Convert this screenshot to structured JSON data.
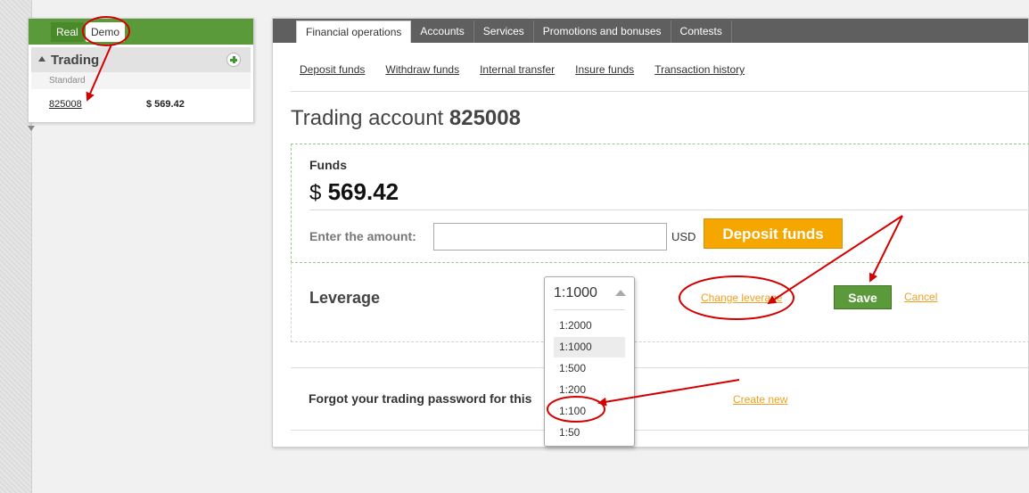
{
  "left_panel": {
    "tabs": [
      "Real",
      "Demo"
    ],
    "section_title": "Trading",
    "sub_label": "Standard",
    "account_number": "825008",
    "balance": "$ 569.42"
  },
  "main": {
    "tabs": [
      "Financial operations",
      "Accounts",
      "Services",
      "Promotions and bonuses",
      "Contests"
    ],
    "subnav": [
      "Deposit funds",
      "Withdraw funds",
      "Internal transfer",
      "Insure funds",
      "Transaction history"
    ],
    "title_prefix": "Trading account",
    "title_account": "825008",
    "funds_label": "Funds",
    "funds_currency": "$",
    "funds_value": "569.42",
    "enter_amount_label": "Enter the amount:",
    "amount_value": "",
    "currency": "USD",
    "deposit_button": "Deposit funds",
    "leverage_label": "Leverage",
    "change_leverage": "Change leverage",
    "save_button": "Save",
    "cancel_link": "Cancel",
    "forgot_text": "Forgot your trading password for this",
    "create_new": "Create new"
  },
  "leverage_dropdown": {
    "selected": "1:1000",
    "options": [
      "1:2000",
      "1:1000",
      "1:500",
      "1:200",
      "1:100",
      "1:50"
    ],
    "highlighted": "1:1000"
  },
  "colors": {
    "green": "#5a9a3b",
    "orange": "#f5a700",
    "link_orange": "#f0a020",
    "dark_tabbar": "#5f5f5f",
    "annotation_red": "#d40000"
  }
}
